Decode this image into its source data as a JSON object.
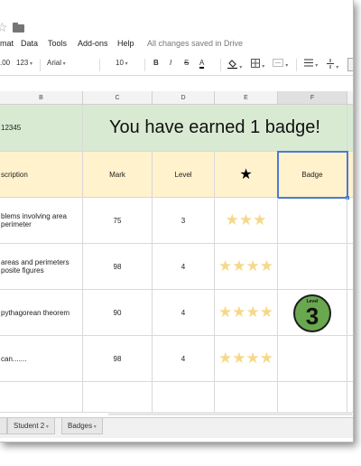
{
  "menu": {
    "items": [
      "mat",
      "Data",
      "Tools",
      "Add-ons",
      "Help"
    ],
    "saved_status": "All changes saved in Drive"
  },
  "toolbar": {
    "decimals": ".00",
    "number_format": "123",
    "font": "Arial",
    "font_size": "10",
    "bold": "B",
    "italic": "I",
    "strike": "S",
    "text_color": "A"
  },
  "columns": [
    "B",
    "C",
    "D",
    "E",
    "F"
  ],
  "sheet": {
    "id_fragment": "12345",
    "headline": "You have earned 1 badge!",
    "headers": {
      "description": "scription",
      "mark": "Mark",
      "level": "Level",
      "star": "★",
      "badge": "Badge"
    },
    "rows": [
      {
        "description": "blems involving area perimeter",
        "mark": "75",
        "level": "3",
        "stars": 3
      },
      {
        "description": "areas and perimeters posite figures",
        "mark": "98",
        "level": "4",
        "stars": 4
      },
      {
        "description": "pythagorean theorem",
        "mark": "90",
        "level": "4",
        "stars": 4
      },
      {
        "description": "can.......",
        "mark": "98",
        "level": "4",
        "stars": 4
      }
    ],
    "badge": {
      "label": "Level",
      "value": "3",
      "color": "#6aa84f"
    }
  },
  "tabs": [
    "Student 2",
    "Badges"
  ],
  "colors": {
    "header_green": "#d9ead3",
    "header_cream": "#fff2cc",
    "star_gold": "#f5d98a",
    "selection_blue": "#4a7bd6"
  }
}
